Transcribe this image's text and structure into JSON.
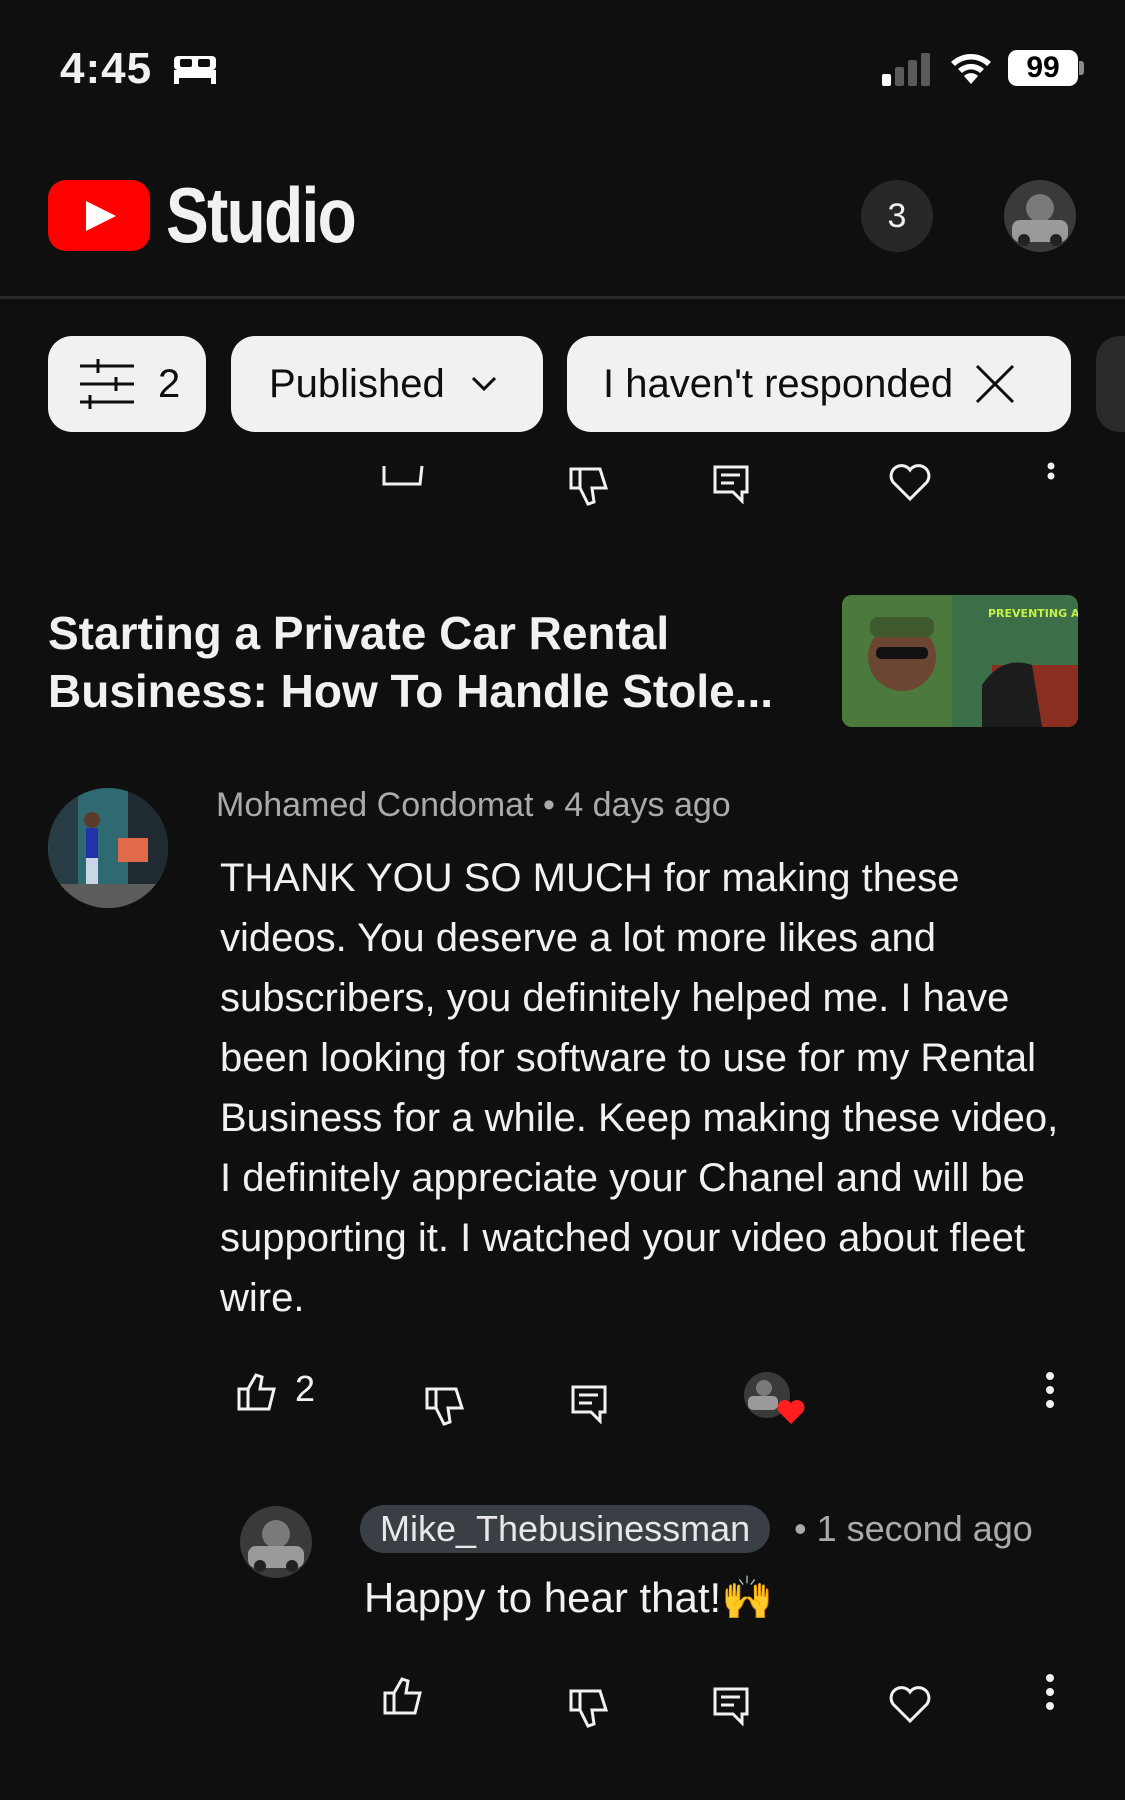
{
  "status_bar": {
    "time": "4:45",
    "battery": "99"
  },
  "header": {
    "logo_text": "Studio",
    "notification_count": "3"
  },
  "filters": {
    "filter_count": "2",
    "published_label": "Published",
    "responded_label": "I haven't responded"
  },
  "video": {
    "title": "Starting a Private Car Rental Business: How To Handle Stole...",
    "thumbnail_text": "PREVENTING AND DEALING WITH CAR THEFTS IN YOUR RENTAL CAR BUSINESS"
  },
  "comment": {
    "author": "Mohamed Condomat",
    "time": "4 days ago",
    "text": "THANK YOU SO MUCH for making these videos. You deserve a lot more likes and subscribers, you definitely helped me. I have been looking for software to use for my Rental Business for a while. Keep making these video, I definitely appreciate your Chanel and will be supporting it. I watched your video about fleet wire.",
    "like_count": "2"
  },
  "reply": {
    "author": "Mike_Thebusinessman",
    "time": "1 second ago",
    "text": "Happy to hear that!🙌"
  },
  "icons": [
    "play-icon",
    "bed-icon",
    "signal-icon",
    "wifi-icon",
    "battery-icon",
    "filter-icon",
    "chevron-down-icon",
    "close-icon",
    "like-icon",
    "dislike-icon",
    "reply-icon",
    "heart-icon",
    "more-icon"
  ]
}
